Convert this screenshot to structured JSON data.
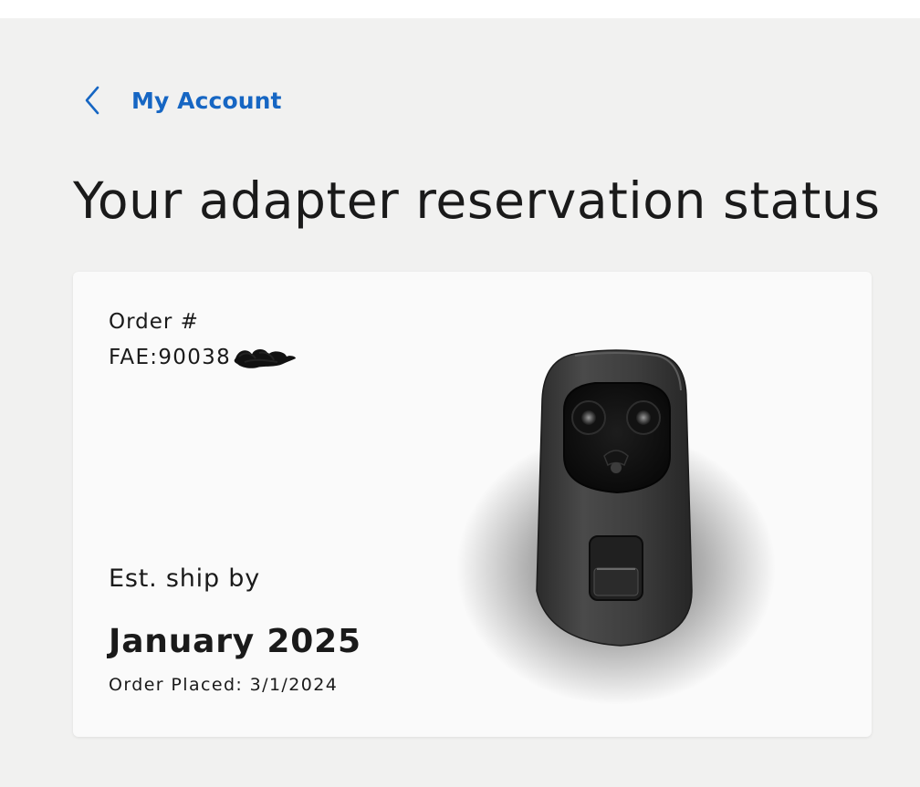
{
  "nav": {
    "back_label": "My Account",
    "back_icon": "chevron-left-icon"
  },
  "page": {
    "title": "Your adapter reservation status"
  },
  "reservation": {
    "order_label": "Order #",
    "order_number": "FAE:90038",
    "est_ship_label": "Est. ship by",
    "est_ship_date": "January 2025",
    "order_placed": "Order Placed: 3/1/2024",
    "product_image": "NACS charging adapter"
  },
  "colors": {
    "link": "#1666c3",
    "page_background": "#f1f1f0",
    "card_background": "#fafafa",
    "text": "#1a1a1a"
  }
}
